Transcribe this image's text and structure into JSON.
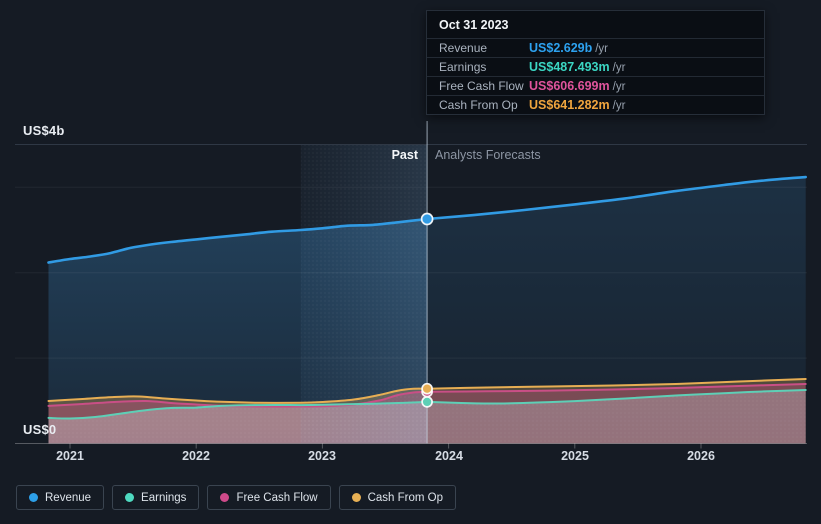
{
  "page": {
    "background": "#151b24"
  },
  "tooltip": {
    "date": "Oct 31 2023",
    "rows": [
      {
        "label": "Revenue",
        "value": "US$2.629b",
        "suffix": "/yr",
        "color": "#2da2f0"
      },
      {
        "label": "Earnings",
        "value": "US$487.493m",
        "suffix": "/yr",
        "color": "#3bd6c3"
      },
      {
        "label": "Free Cash Flow",
        "value": "US$606.699m",
        "suffix": "/yr",
        "color": "#e0549c"
      },
      {
        "label": "Cash From Op",
        "value": "US$641.282m",
        "suffix": "/yr",
        "color": "#f0a53e"
      }
    ]
  },
  "axis": {
    "y_top_label": "US$4b",
    "y_bottom_label": "US$0",
    "x_ticks": [
      "2021",
      "2022",
      "2023",
      "2024",
      "2025",
      "2026"
    ]
  },
  "annotations": {
    "past": "Past",
    "forecast": "Analysts Forecasts"
  },
  "legend": [
    {
      "label": "Revenue",
      "color": "#2d9fe8"
    },
    {
      "label": "Earnings",
      "color": "#4ed9c0"
    },
    {
      "label": "Free Cash Flow",
      "color": "#ce4a8a"
    },
    {
      "label": "Cash From Op",
      "color": "#e8b054"
    }
  ],
  "chart_data": {
    "type": "area",
    "unit": "USD billions per year",
    "xlim": [
      2020.83,
      2026.83
    ],
    "ylim": [
      0,
      3.5
    ],
    "y_gridlines": [
      1,
      2,
      3
    ],
    "x_tick_years": [
      2021,
      2022,
      2023,
      2024,
      2025,
      2026
    ],
    "divider_x": 2023.83,
    "divider_date": "Oct 31 2023",
    "highlight_band": [
      2022.83,
      2023.83
    ],
    "legend_position": "bottom",
    "series": [
      {
        "name": "Revenue",
        "color": "#319be4",
        "past": {
          "x": [
            2020.83,
            2021.0,
            2021.16,
            2021.32,
            2021.48,
            2021.64,
            2021.8,
            2022.0,
            2022.2,
            2022.4,
            2022.6,
            2022.83,
            2023.0,
            2023.2,
            2023.4,
            2023.6,
            2023.83
          ],
          "values": [
            2.12,
            2.16,
            2.19,
            2.23,
            2.29,
            2.33,
            2.36,
            2.39,
            2.42,
            2.45,
            2.48,
            2.5,
            2.52,
            2.55,
            2.56,
            2.59,
            2.629
          ]
        },
        "forecast": {
          "x": [
            2023.83,
            2024.2,
            2024.6,
            2025.0,
            2025.4,
            2025.8,
            2026.2,
            2026.5,
            2026.83
          ],
          "values": [
            2.629,
            2.675,
            2.734,
            2.8,
            2.87,
            2.956,
            3.03,
            3.08,
            3.12
          ]
        }
      },
      {
        "name": "Cash From Op",
        "color": "#e7ae54",
        "past": {
          "x": [
            2020.83,
            2021.1,
            2021.35,
            2021.55,
            2021.75,
            2022.0,
            2022.2,
            2022.5,
            2022.83,
            2023.0,
            2023.25,
            2023.45,
            2023.6,
            2023.72,
            2023.83
          ],
          "values": [
            0.498,
            0.521,
            0.545,
            0.55,
            0.527,
            0.503,
            0.488,
            0.477,
            0.477,
            0.486,
            0.515,
            0.568,
            0.62,
            0.641,
            0.641
          ]
        },
        "forecast": {
          "x": [
            2023.83,
            2024.3,
            2024.8,
            2025.3,
            2025.8,
            2026.3,
            2026.83
          ],
          "values": [
            0.641,
            0.656,
            0.667,
            0.679,
            0.697,
            0.726,
            0.755
          ]
        }
      },
      {
        "name": "Free Cash Flow",
        "color": "#c94f86",
        "past": {
          "x": [
            2020.83,
            2021.1,
            2021.35,
            2021.6,
            2021.8,
            2022.0,
            2022.2,
            2022.5,
            2022.83,
            2023.0,
            2023.25,
            2023.45,
            2023.6,
            2023.72,
            2023.83
          ],
          "values": [
            0.44,
            0.462,
            0.486,
            0.498,
            0.474,
            0.457,
            0.441,
            0.433,
            0.433,
            0.436,
            0.457,
            0.503,
            0.568,
            0.597,
            0.607
          ]
        },
        "forecast": {
          "x": [
            2023.83,
            2024.3,
            2024.8,
            2025.3,
            2025.8,
            2026.3,
            2026.83
          ],
          "values": [
            0.607,
            0.611,
            0.62,
            0.632,
            0.65,
            0.673,
            0.697
          ]
        }
      },
      {
        "name": "Earnings",
        "color": "#5ecfb6",
        "past": {
          "x": [
            2020.83,
            2021.0,
            2021.2,
            2021.4,
            2021.6,
            2021.8,
            2022.0,
            2022.2,
            2022.5,
            2022.83,
            2023.0,
            2023.3,
            2023.6,
            2023.83
          ],
          "values": [
            0.3,
            0.293,
            0.31,
            0.35,
            0.39,
            0.416,
            0.42,
            0.44,
            0.45,
            0.45,
            0.453,
            0.462,
            0.474,
            0.487
          ]
        },
        "forecast": {
          "x": [
            2023.83,
            2024.1,
            2024.4,
            2024.7,
            2025.0,
            2025.4,
            2025.8,
            2026.2,
            2026.5,
            2026.83
          ],
          "values": [
            0.487,
            0.474,
            0.468,
            0.48,
            0.497,
            0.527,
            0.562,
            0.59,
            0.61,
            0.626
          ]
        }
      }
    ],
    "markers": [
      {
        "series": "Earnings",
        "value": 0.487493
      },
      {
        "series": "Free Cash Flow",
        "value": 0.606699
      },
      {
        "series": "Cash From Op",
        "value": 0.641282
      },
      {
        "series": "Revenue",
        "value": 2.629
      }
    ]
  }
}
